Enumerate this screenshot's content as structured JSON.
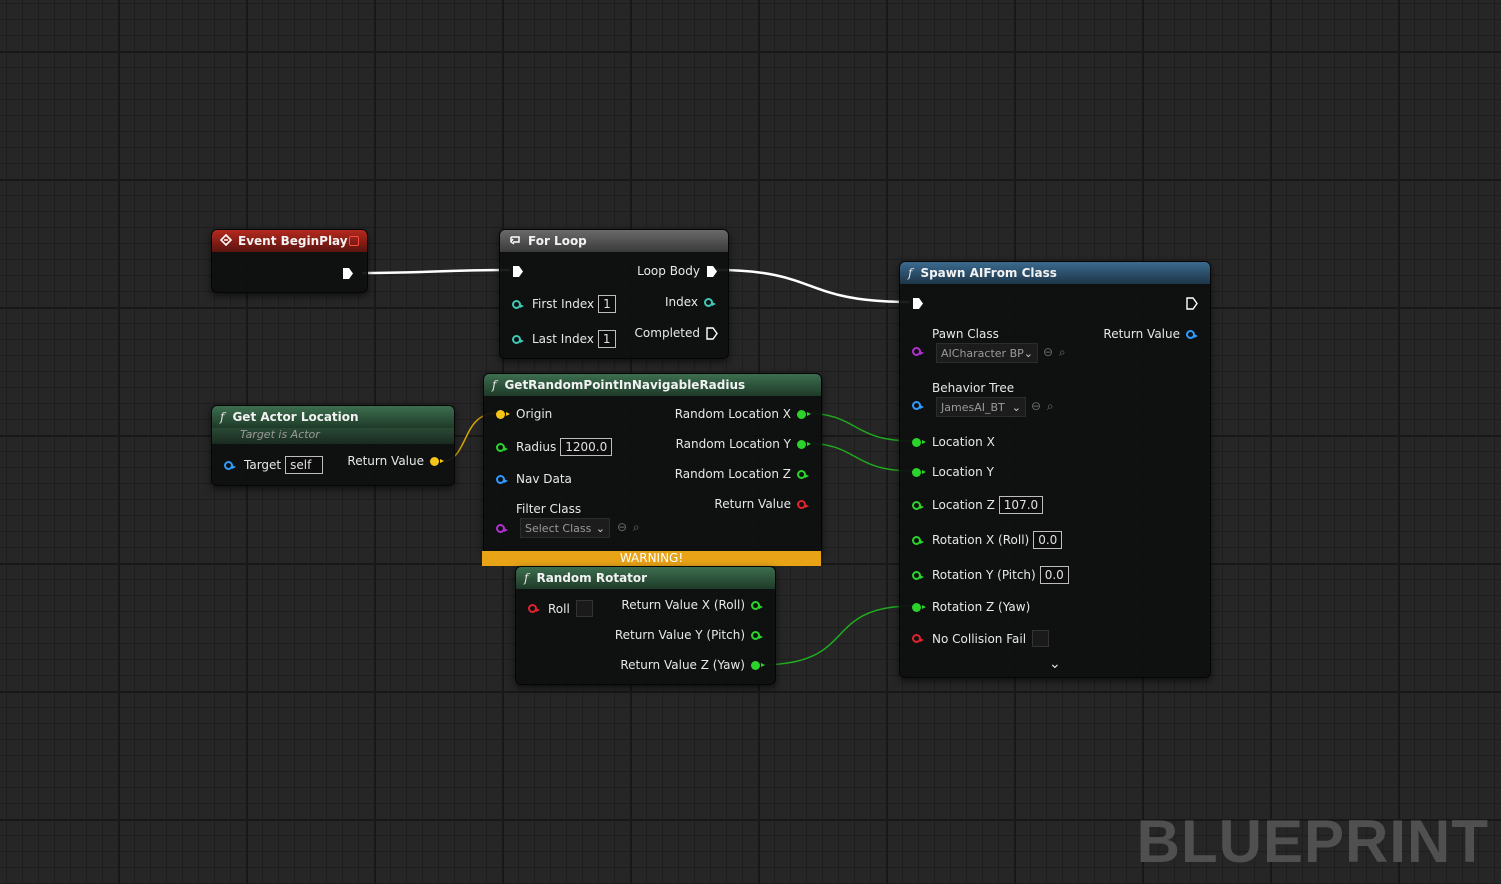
{
  "watermark": "BLUEPRINT",
  "colors": {
    "exec": "#ffffff",
    "float": "#2bd42b",
    "int": "#3fc9b5",
    "object": "#2e9bff",
    "vector": "#f5c518",
    "class": "#b02fd0",
    "bool": "#e0242e",
    "warning": "#e8a317"
  },
  "event_begin_play": {
    "title": "Event BeginPlay",
    "icon": "event-diamond-icon"
  },
  "for_loop": {
    "title": "For Loop",
    "icon": "loop-icon",
    "first_index_label": "First Index",
    "first_index_value": "1",
    "last_index_label": "Last Index",
    "last_index_value": "1",
    "loop_body_label": "Loop Body",
    "index_label": "Index",
    "completed_label": "Completed"
  },
  "get_actor_location": {
    "title": "Get Actor Location",
    "subtitle": "Target is Actor",
    "target_label": "Target",
    "target_value": "self",
    "return_label": "Return Value"
  },
  "get_random_point": {
    "title": "GetRandomPointInNavigableRadius",
    "origin_label": "Origin",
    "radius_label": "Radius",
    "radius_value": "1200.0",
    "nav_data_label": "Nav Data",
    "filter_class_label": "Filter Class",
    "filter_class_value": "Select Class",
    "out_x": "Random Location X",
    "out_y": "Random Location Y",
    "out_z": "Random Location Z",
    "return_label": "Return Value",
    "warning": "WARNING!"
  },
  "random_rotator": {
    "title": "Random Rotator",
    "roll_label": "Roll",
    "out_x": "Return Value X (Roll)",
    "out_y": "Return Value Y (Pitch)",
    "out_z": "Return Value Z (Yaw)"
  },
  "spawn_ai": {
    "title": "Spawn AIFrom Class",
    "pawn_class_label": "Pawn Class",
    "pawn_class_value": "AICharacter BP",
    "return_label": "Return Value",
    "behavior_tree_label": "Behavior Tree",
    "behavior_tree_value": "JamesAI_BT",
    "location_x_label": "Location X",
    "location_y_label": "Location Y",
    "location_z_label": "Location Z",
    "location_z_value": "107.0",
    "rotation_x_label": "Rotation X (Roll)",
    "rotation_x_value": "0.0",
    "rotation_y_label": "Rotation Y (Pitch)",
    "rotation_y_value": "0.0",
    "rotation_z_label": "Rotation Z (Yaw)",
    "no_collision_label": "No Collision Fail"
  }
}
